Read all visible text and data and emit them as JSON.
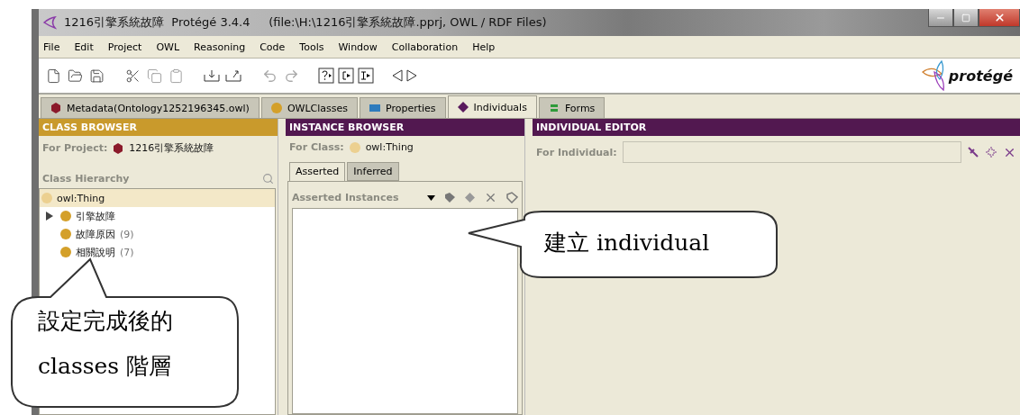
{
  "window": {
    "title": "1216引擎系統故障  Protégé 3.4.4     (file:\\H:\\1216引擎系統故障.pprj, OWL / RDF Files)"
  },
  "menu": [
    "File",
    "Edit",
    "Project",
    "OWL",
    "Reasoning",
    "Code",
    "Tools",
    "Window",
    "Collaboration",
    "Help"
  ],
  "logo": {
    "text": "protégé"
  },
  "tabs": [
    {
      "label": "Metadata(Ontology1252196345.owl)",
      "kind": "hexagon",
      "color": "#8b1a2b",
      "selected": false
    },
    {
      "label": "OWLClasses",
      "kind": "circle",
      "color": "#d4a02a",
      "selected": false
    },
    {
      "label": "Properties",
      "kind": "square",
      "color": "#2e7bbd",
      "selected": false
    },
    {
      "label": "Individuals",
      "kind": "diamond",
      "color": "#5a1a5e",
      "selected": true
    },
    {
      "label": "Forms",
      "kind": "bars",
      "color": "#2e9a3a",
      "selected": false
    }
  ],
  "class_browser": {
    "title": "CLASS BROWSER",
    "project_label": "For Project:",
    "project": "1216引擎系統故障",
    "hierarchy_label": "Class Hierarchy",
    "tree": [
      {
        "label": "owl:Thing",
        "selected": true,
        "children": [
          {
            "label": "引擎故障",
            "selected": false,
            "expanded": false
          },
          {
            "label": "故障原因",
            "count": "(9)",
            "selected": false
          },
          {
            "label": "相關說明",
            "count": "(7)",
            "selected": false
          }
        ]
      }
    ]
  },
  "instance_browser": {
    "title": "INSTANCE BROWSER",
    "class_label": "For Class:",
    "class": "owl:Thing",
    "tabs": [
      {
        "label": "Asserted",
        "selected": true
      },
      {
        "label": "Inferred",
        "selected": false
      }
    ],
    "list_label": "Asserted Instances"
  },
  "individual_editor": {
    "title": "INDIVIDUAL EDITOR",
    "field_label": "For Individual:"
  },
  "callouts": [
    {
      "lines": [
        "設定完成後的",
        "classes 階層"
      ]
    },
    {
      "lines": [
        "建立 individual"
      ]
    }
  ]
}
